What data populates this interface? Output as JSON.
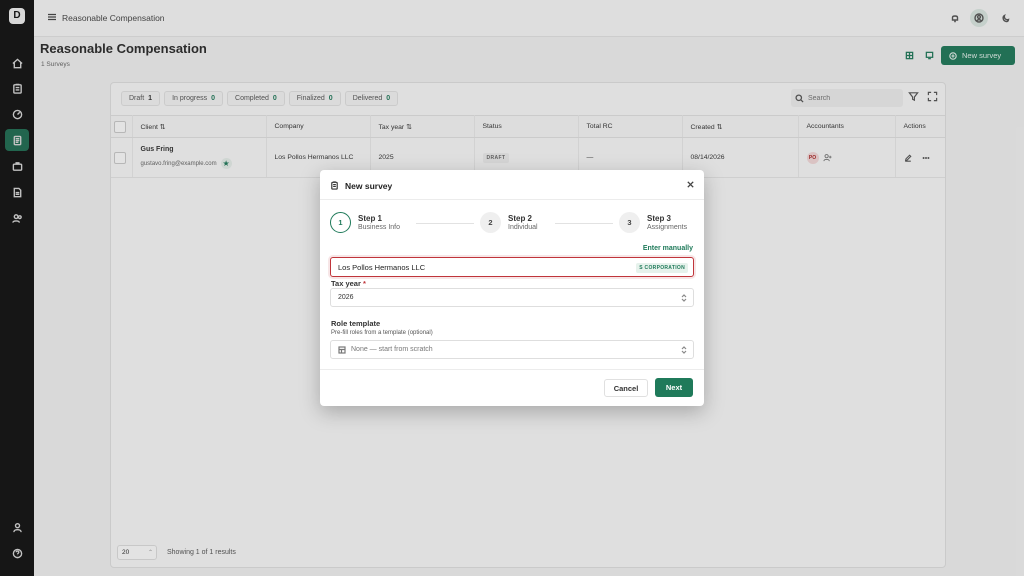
{
  "app": {
    "logo_text": "D",
    "topbar_title": "Reasonable Compensation"
  },
  "page": {
    "title": "Reasonable Compensation",
    "subtitle": "1 Surveys",
    "new_survey_label": "New survey"
  },
  "filters": [
    {
      "label": "Draft",
      "count": "1"
    },
    {
      "label": "In progress",
      "count": "0"
    },
    {
      "label": "Completed",
      "count": "0"
    },
    {
      "label": "Finalized",
      "count": "0"
    },
    {
      "label": "Delivered",
      "count": "0"
    }
  ],
  "search": {
    "placeholder": "Search"
  },
  "table": {
    "headers": {
      "client": "Client ⇅",
      "company": "Company",
      "tax_year": "Tax year ⇅",
      "status": "Status",
      "total_rc": "Total RC",
      "created": "Created ⇅",
      "accountants": "Accountants",
      "actions": "Actions"
    },
    "rows": [
      {
        "client_name": "Gus Fring",
        "client_email": "gustavo.fring@example.com",
        "company": "Los Pollos Hermanos LLC",
        "tax_year": "2025",
        "status": "DRAFT",
        "total_rc": "—",
        "created": "08/14/2026",
        "accountant_initials": "PO"
      }
    ]
  },
  "pager": {
    "page_size": "20",
    "info": "Showing 1 of 1 results"
  },
  "modal": {
    "title": "New survey",
    "steps": [
      {
        "num": "1",
        "title": "Step 1",
        "subtitle": "Business Info"
      },
      {
        "num": "2",
        "title": "Step 2",
        "subtitle": "Individual"
      },
      {
        "num": "3",
        "title": "Step 3",
        "subtitle": "Assignments"
      }
    ],
    "enter_manually": "Enter manually",
    "company_value": "Los Pollos Hermanos LLC",
    "company_badge": "S CORPORATION",
    "tax_year_label": "Tax year",
    "tax_year_required": "*",
    "tax_year_value": "2026",
    "role_template_label": "Role template",
    "role_template_hint": "Pre-fill roles from a template (optional)",
    "role_template_value": "None — start from scratch",
    "cancel_label": "Cancel",
    "next_label": "Next"
  },
  "colors": {
    "accent": "#1f7a5a",
    "error": "#c0353b",
    "rail": "#111111"
  }
}
